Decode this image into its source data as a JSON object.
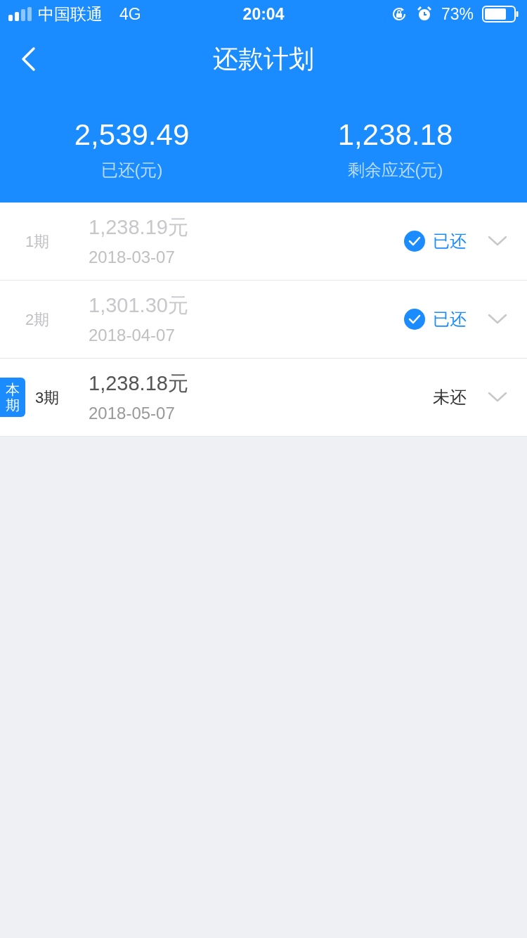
{
  "status_bar": {
    "carrier": "中国联通",
    "network": "4G",
    "time": "20:04",
    "battery": "73%"
  },
  "header": {
    "title": "还款计划"
  },
  "summary": [
    {
      "amount": "2,539.49",
      "label": "已还(元)"
    },
    {
      "amount": "1,238.18",
      "label": "剩余应还(元)"
    }
  ],
  "installments": [
    {
      "period": "1期",
      "amount": "1,238.19元",
      "date": "2018-03-07",
      "status": "已还",
      "paid": true,
      "current": false
    },
    {
      "period": "2期",
      "amount": "1,301.30元",
      "date": "2018-04-07",
      "status": "已还",
      "paid": true,
      "current": false
    },
    {
      "period": "3期",
      "amount": "1,238.18元",
      "date": "2018-05-07",
      "status": "未还",
      "paid": false,
      "current": true,
      "badge": "本期"
    }
  ]
}
